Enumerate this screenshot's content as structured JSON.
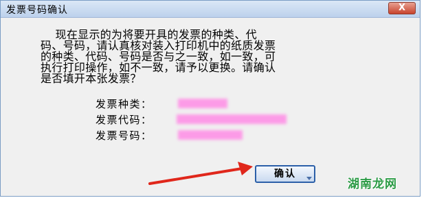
{
  "window": {
    "title": "发票号码确认",
    "close_label": "X"
  },
  "message": "    现在显示的为将要开具的发票的种类、代\n码、号码，请认真核对装入打印机中的纸质发票\n的种类、代码、号码是否与之一致，如一致，可\n执行打印操作，如不一致，请予以更换。请确认\n是否填开本张发票？",
  "fields": [
    {
      "label": "发票种类："
    },
    {
      "label": "发票代码："
    },
    {
      "label": "发票号码："
    }
  ],
  "buttons": {
    "confirm_label": "确认"
  },
  "annotation": {
    "arrow_color": "#e0271b"
  },
  "watermark": "湖南龙网"
}
